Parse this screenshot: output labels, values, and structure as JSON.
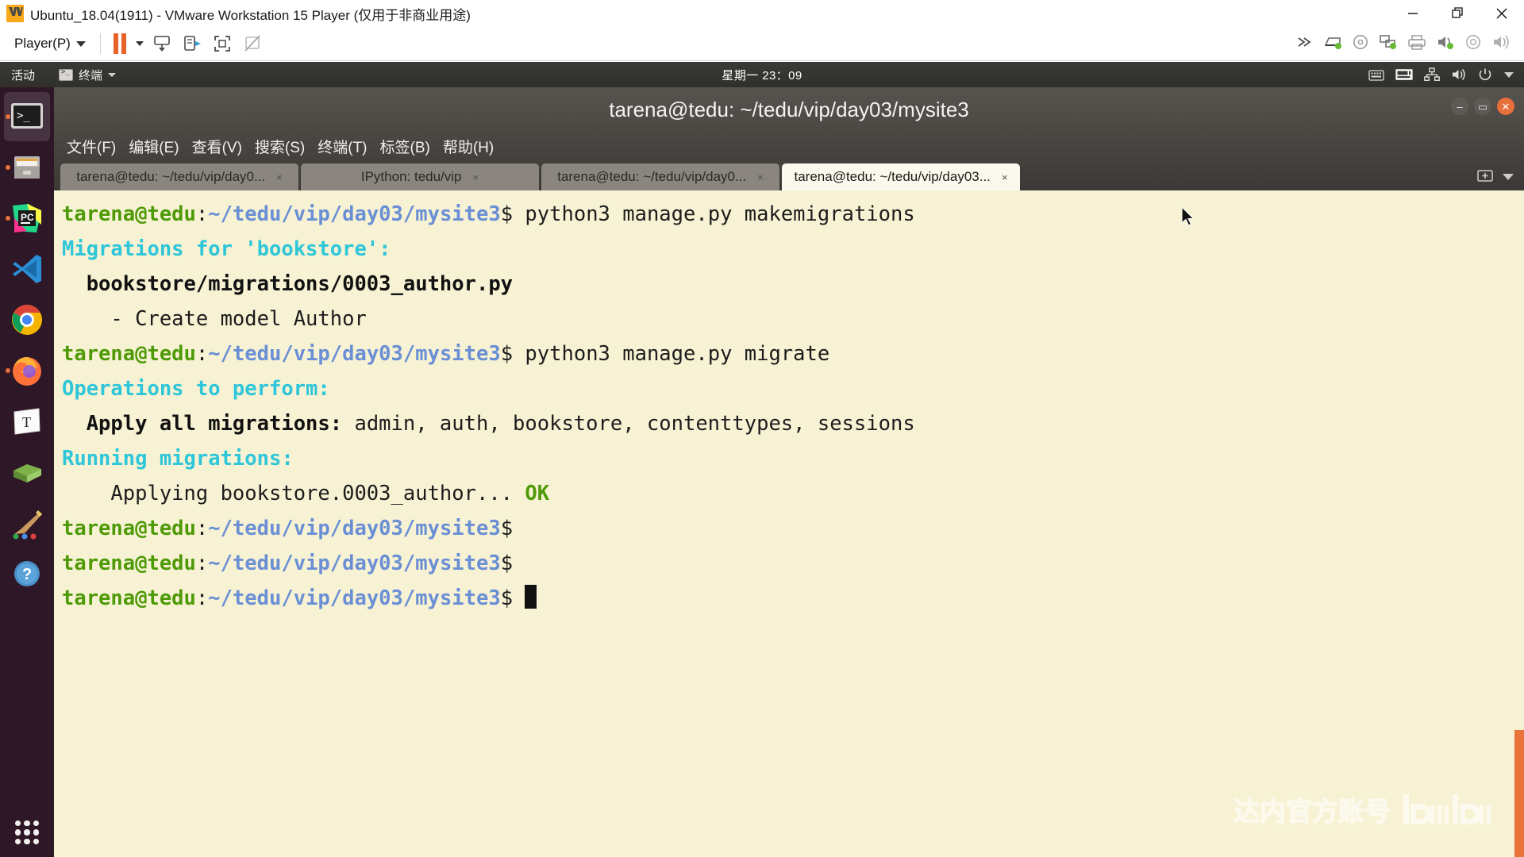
{
  "vmware": {
    "title": "Ubuntu_18.04(1911) - VMware Workstation 15 Player (仅用于非商业用途)",
    "logo_icon": "vmware-logo-icon",
    "window_controls": [
      {
        "name": "minimize-icon",
        "label": "—"
      },
      {
        "name": "restore-icon",
        "label": "❐"
      },
      {
        "name": "close-icon",
        "label": "✕"
      }
    ],
    "toolbar": {
      "player_menu_label": "Player(P)",
      "dropdown_icon": "chevron-down-icon",
      "pause_icon": "pause-icon",
      "pause_dropdown_icon": "chevron-down-small-icon",
      "buttons": [
        {
          "name": "send-ctrl-alt-del-icon"
        },
        {
          "name": "unity-mode-icon"
        },
        {
          "name": "full-screen-icon"
        },
        {
          "name": "disconnect-display-icon"
        }
      ],
      "right_icons": [
        {
          "name": "expand-toolbar-icon"
        },
        {
          "name": "hard-disk-icon"
        },
        {
          "name": "cd-dvd-icon"
        },
        {
          "name": "network-adapter-icon"
        },
        {
          "name": "printer-icon"
        },
        {
          "name": "sound-card-icon"
        },
        {
          "name": "usb-controller-icon"
        },
        {
          "name": "speaker-icon"
        }
      ]
    }
  },
  "ubuntu": {
    "topbar": {
      "activities_label": "活动",
      "app_icon": "terminal-app-icon",
      "app_name": "终端",
      "app_caret_icon": "chevron-down-icon",
      "clock": "星期一 23：09",
      "tray": [
        {
          "name": "onscreen-keyboard-icon"
        },
        {
          "name": "keyboard-layout-icon"
        },
        {
          "name": "network-icon"
        },
        {
          "name": "volume-icon"
        },
        {
          "name": "power-icon"
        },
        {
          "name": "system-menu-caret-icon"
        }
      ]
    },
    "dock": {
      "items": [
        {
          "name": "dock-item-terminal",
          "icon": "terminal-icon",
          "active": true,
          "running": true
        },
        {
          "name": "dock-item-files",
          "icon": "files-icon",
          "active": false,
          "running": true
        },
        {
          "name": "dock-item-pycharm",
          "icon": "pycharm-icon",
          "active": false,
          "running": true
        },
        {
          "name": "dock-item-vscode",
          "icon": "vscode-icon",
          "active": false,
          "running": false
        },
        {
          "name": "dock-item-chrome",
          "icon": "google-chrome-icon",
          "active": false,
          "running": false
        },
        {
          "name": "dock-item-firefox",
          "icon": "firefox-icon",
          "active": false,
          "running": true
        },
        {
          "name": "dock-item-text-editor",
          "icon": "text-editor-icon",
          "active": false,
          "running": false
        },
        {
          "name": "dock-item-books",
          "icon": "books-icon",
          "active": false,
          "running": false
        },
        {
          "name": "dock-item-paint",
          "icon": "paint-brush-icon",
          "active": false,
          "running": false
        },
        {
          "name": "dock-item-help",
          "icon": "help-question-icon",
          "active": false,
          "running": false
        }
      ],
      "show_apps_icon": "show-applications-grid-icon"
    }
  },
  "terminal": {
    "window_title": "tarena@tedu: ~/tedu/vip/day03/mysite3",
    "window_controls": [
      {
        "name": "terminal-minimize-button",
        "glyph": "–"
      },
      {
        "name": "terminal-maximize-button",
        "glyph": "▭"
      },
      {
        "name": "terminal-close-button",
        "glyph": "✕"
      }
    ],
    "menus": [
      "文件(F)",
      "编辑(E)",
      "查看(V)",
      "搜索(S)",
      "终端(T)",
      "标签(B)",
      "帮助(H)"
    ],
    "tabs": [
      {
        "label": "tarena@tedu: ~/tedu/vip/day0...",
        "close": "×",
        "active": false
      },
      {
        "label": "IPython: tedu/vip",
        "close": "×",
        "active": false
      },
      {
        "label": "tarena@tedu: ~/tedu/vip/day0...",
        "close": "×",
        "active": false
      },
      {
        "label": "tarena@tedu: ~/tedu/vip/day03...",
        "close": "×",
        "active": true
      }
    ],
    "tabs_right": [
      {
        "name": "new-tab-button",
        "icon": "add-tab-icon"
      },
      {
        "name": "tab-list-button",
        "icon": "chevron-down-icon"
      }
    ],
    "prompt": {
      "user_host": "tarena@tedu",
      "colon": ":",
      "path": "~/tedu/vip/day03/mysite3",
      "sigil": "$"
    },
    "lines": [
      {
        "type": "prompt",
        "command": " python3 manage.py makemigrations"
      },
      {
        "type": "cyan",
        "text": "Migrations for 'bookstore':"
      },
      {
        "type": "bold",
        "text": "  bookstore/migrations/0003_author.py"
      },
      {
        "type": "plain",
        "text": "    - Create model Author"
      },
      {
        "type": "prompt",
        "command": " python3 manage.py migrate"
      },
      {
        "type": "cyan",
        "text": "Operations to perform:"
      },
      {
        "type": "mixed-bold",
        "bold_text": "  Apply all migrations:",
        "rest": " admin, auth, bookstore, contenttypes, sessions"
      },
      {
        "type": "cyan",
        "text": "Running migrations:"
      },
      {
        "type": "mixed-ok",
        "text": "    Applying bookstore.0003_author... ",
        "ok": "OK"
      },
      {
        "type": "prompt",
        "command": ""
      },
      {
        "type": "prompt",
        "command": ""
      },
      {
        "type": "prompt-cursor",
        "command": " "
      }
    ],
    "watermark": {
      "text": "达内官方账号",
      "logo": "bilibili-logo-icon"
    },
    "scrollbar": {
      "name": "terminal-scrollbar",
      "color": "#e8743a"
    }
  },
  "colors": {
    "terminal_bg": "#f7f2d4",
    "prompt_green": "#4e9a06",
    "prompt_blue": "#6a8fd4",
    "output_cyan": "#2ec6d9",
    "accent_orange": "#e8743a",
    "dock_bg": "#2f1928"
  }
}
